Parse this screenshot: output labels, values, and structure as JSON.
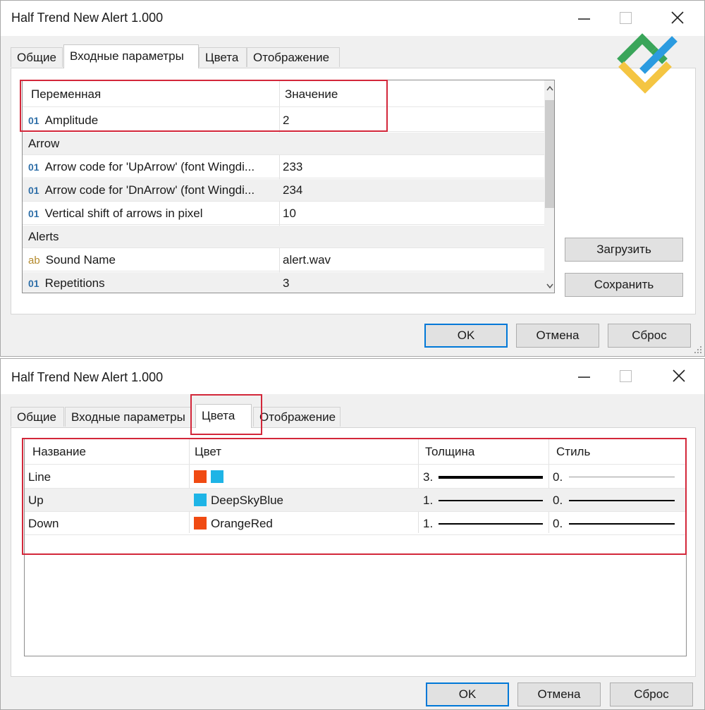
{
  "top_dialog": {
    "title": "Half Trend New Alert 1.000",
    "tabs": [
      "Общие",
      "Входные параметры",
      "Цвета",
      "Отображение"
    ],
    "headers": {
      "variable": "Переменная",
      "value": "Значение"
    },
    "rows": [
      {
        "type": "int",
        "icon": "01",
        "name": "Amplitude",
        "value": "2"
      },
      {
        "type": "group",
        "name": "Arrow",
        "value": ""
      },
      {
        "type": "int",
        "icon": "01",
        "name": "Arrow code for 'UpArrow' (font Wingdi...",
        "value": "233"
      },
      {
        "type": "int",
        "icon": "01",
        "name": "Arrow code for 'DnArrow' (font Wingdi...",
        "value": "234"
      },
      {
        "type": "int",
        "icon": "01",
        "name": "Vertical shift of arrows in pixel",
        "value": "10"
      },
      {
        "type": "group",
        "name": "Alerts",
        "value": ""
      },
      {
        "type": "string",
        "icon": "ab",
        "name": "Sound Name",
        "value": "alert.wav"
      },
      {
        "type": "int",
        "icon": "01",
        "name": "Repetitions",
        "value": "3"
      }
    ],
    "side_buttons": {
      "load": "Загрузить",
      "save": "Сохранить"
    },
    "footer_buttons": {
      "ok": "OK",
      "cancel": "Отмена",
      "reset": "Сброс"
    }
  },
  "bottom_dialog": {
    "title": "Half Trend New Alert 1.000",
    "tabs": [
      "Общие",
      "Входные параметры",
      "Цвета",
      "Отображение"
    ],
    "headers": {
      "name": "Название",
      "color": "Цвет",
      "width": "Толщина",
      "style": "Стиль"
    },
    "rows": [
      {
        "name": "Line",
        "colors": [
          "#f04a12",
          "#1eb4e6"
        ],
        "color_label": "",
        "width": "3.",
        "style": "0."
      },
      {
        "name": "Up",
        "colors": [
          "#1eb4e6"
        ],
        "color_label": "DeepSkyBlue",
        "width": "1.",
        "style": "0."
      },
      {
        "name": "Down",
        "colors": [
          "#f04a12"
        ],
        "color_label": "OrangeRed",
        "width": "1.",
        "style": "0."
      }
    ],
    "footer_buttons": {
      "ok": "OK",
      "cancel": "Отмена",
      "reset": "Сброс"
    }
  },
  "colors": {
    "highlight": "#d3273a",
    "accent": "#0078d7",
    "orange_red": "#f04a12",
    "deep_sky_blue": "#1eb4e6"
  }
}
